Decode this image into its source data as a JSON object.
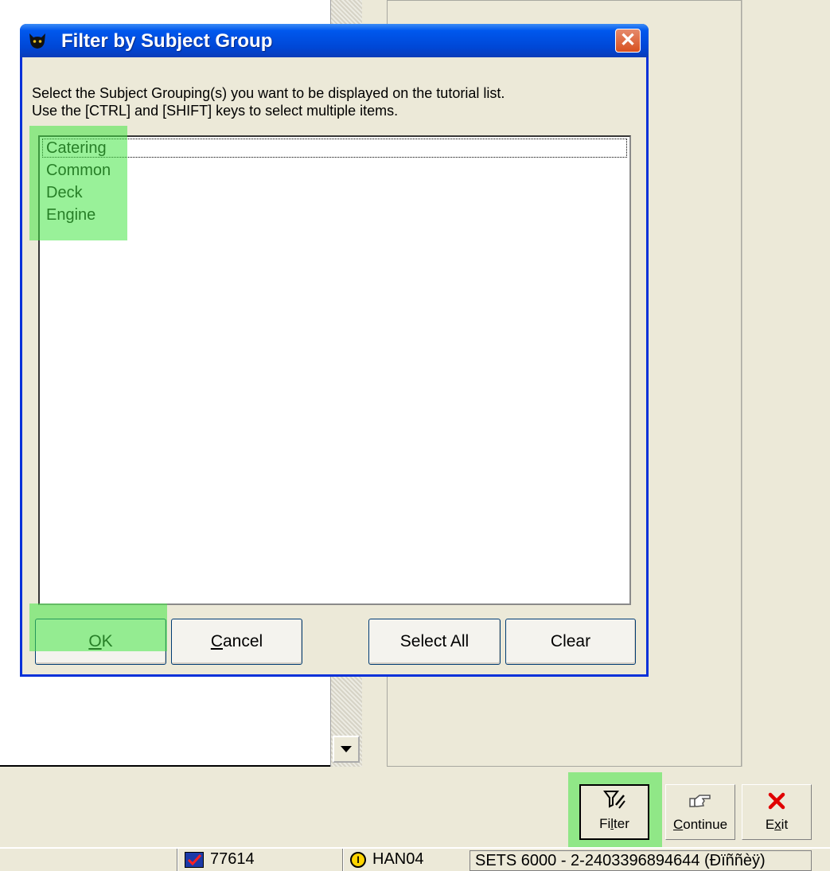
{
  "dialog": {
    "title": "Filter by Subject Group",
    "close_label": "✕",
    "instructions_line1": "Select the Subject Grouping(s) you want to be displayed on the tutorial list.",
    "instructions_line2": "Use the [CTRL] and [SHIFT] keys to select multiple items.",
    "list_items": [
      "Catering",
      "Common",
      "Deck",
      "Engine"
    ],
    "buttons": {
      "ok_mnemonic": "O",
      "ok_rest": "K",
      "cancel_mnemonic": "C",
      "cancel_rest": "ancel",
      "select_all": "Select All",
      "clear": "Clear"
    }
  },
  "toolbar": {
    "filter_pre": "Fi",
    "filter_mnemonic": "l",
    "filter_post": "ter",
    "continue_mnemonic": "C",
    "continue_rest": "ontinue",
    "exit_pre": "E",
    "exit_mnemonic": "x",
    "exit_post": "it"
  },
  "statusbar": {
    "count": "77614",
    "user": "HAN04",
    "product": "SETS 6000 - 2-2403396894644 (Ðïññèÿ)"
  },
  "colors": {
    "titlebar": "#0058ee",
    "highlight": "#46e646",
    "close_button": "#d8501f"
  }
}
